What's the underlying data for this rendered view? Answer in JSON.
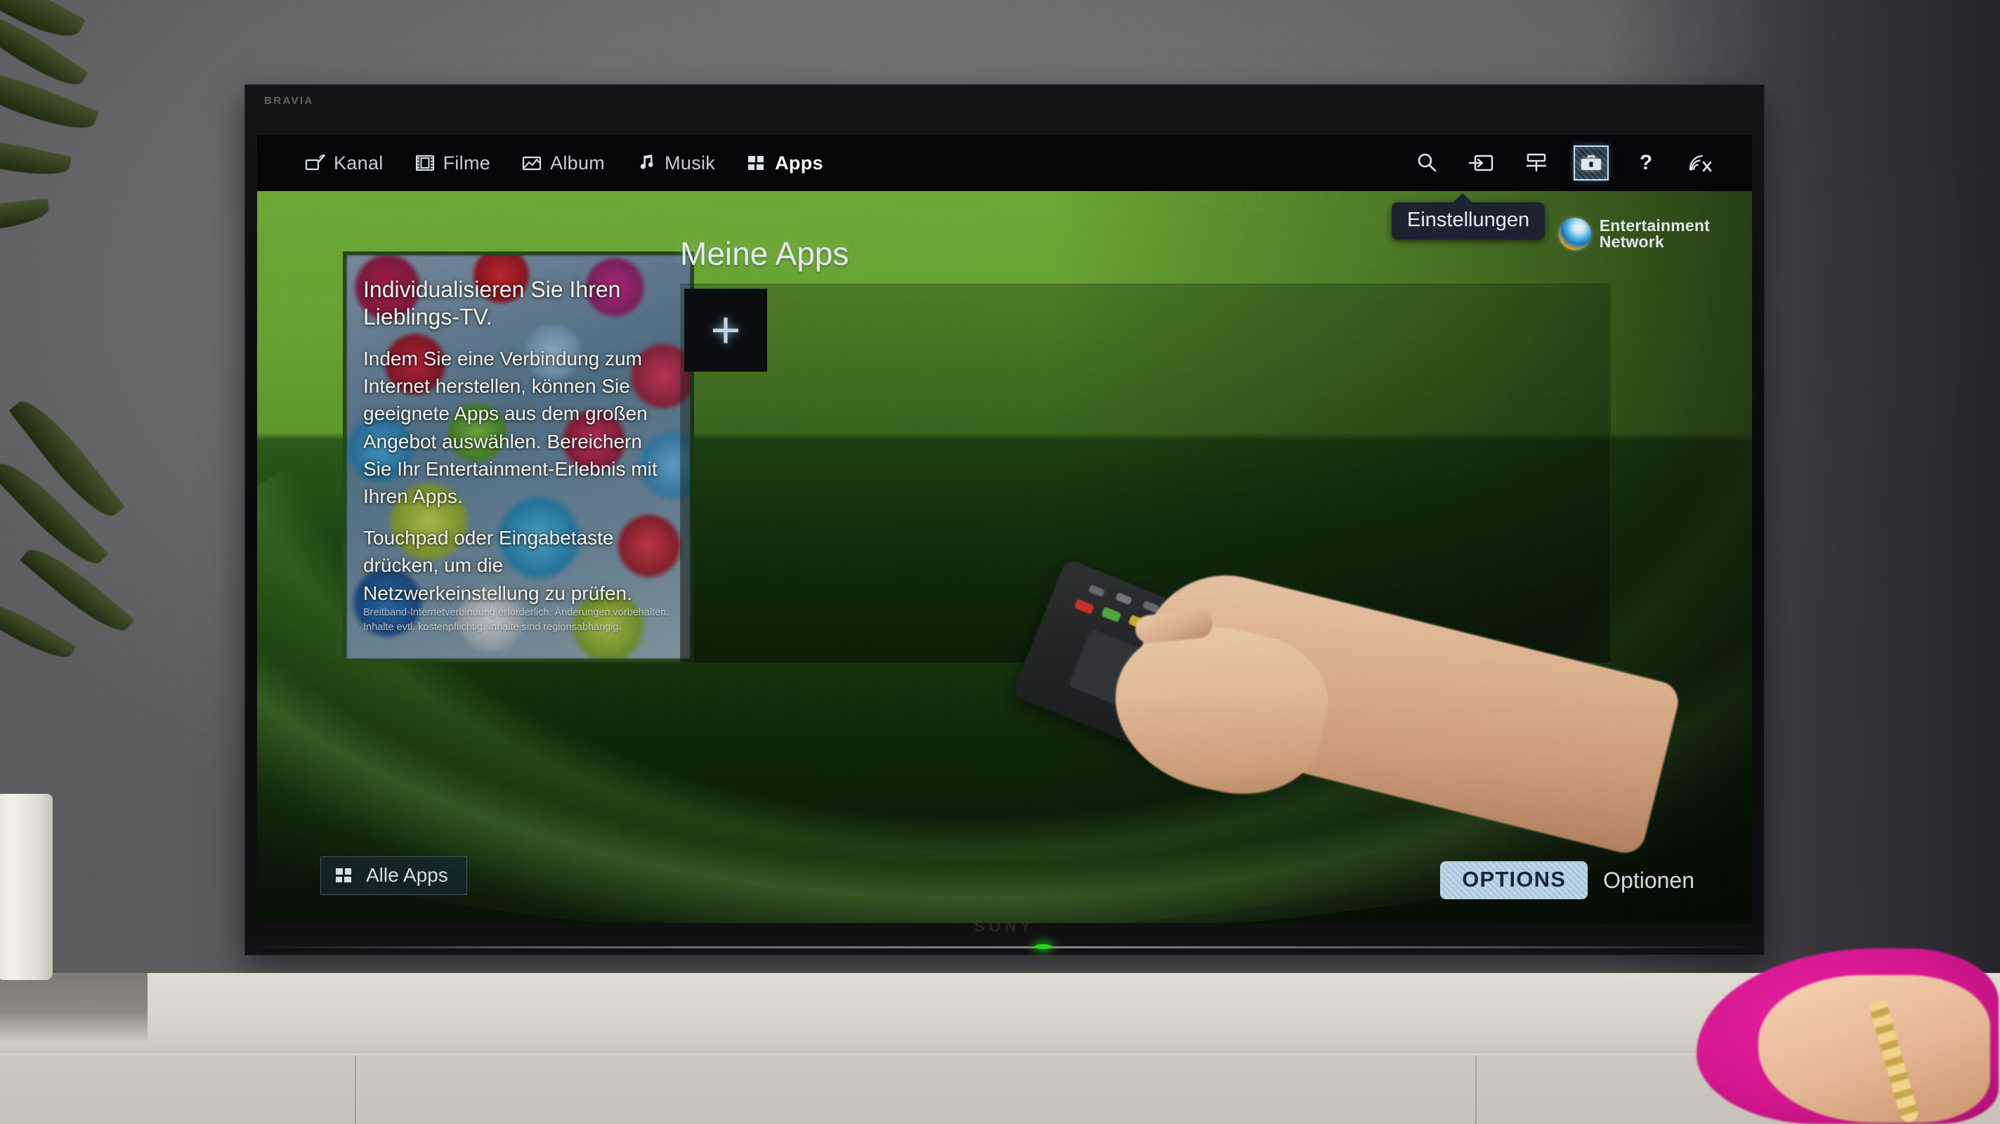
{
  "device": {
    "brand_logo_top": "BRAVIA",
    "brand_logo_bottom": "SONY"
  },
  "topbar": {
    "nav_items": [
      {
        "label": "Kanal",
        "icon": "tv-antenna-icon",
        "active": false
      },
      {
        "label": "Filme",
        "icon": "film-strip-icon",
        "active": false
      },
      {
        "label": "Album",
        "icon": "photo-icon",
        "active": false
      },
      {
        "label": "Musik",
        "icon": "music-note-icon",
        "active": false
      },
      {
        "label": "Apps",
        "icon": "apps-grid-icon",
        "active": true
      }
    ],
    "system_icons": [
      {
        "name": "search-icon",
        "selected": false
      },
      {
        "name": "input-source-icon",
        "selected": false
      },
      {
        "name": "media-server-icon",
        "selected": false
      },
      {
        "name": "settings-toolbox-icon",
        "selected": true
      },
      {
        "name": "help-icon",
        "selected": false
      },
      {
        "name": "network-disconnected-icon",
        "selected": false
      }
    ],
    "tooltip": "Einstellungen"
  },
  "branding": {
    "sen_line1": "Entertainment",
    "sen_line2": "Network",
    "sen_orb_icon": "sony-entertainment-network-orb-icon"
  },
  "promo": {
    "heading": "Individualisieren Sie Ihren Lieblings-TV.",
    "paragraph1": "Indem Sie eine Verbindung zum Internet herstellen, können Sie geeignete Apps aus dem großen Angebot auswählen. Bereichern Sie Ihr Entertainment-Erlebnis mit Ihren Apps.",
    "paragraph2": "Touchpad oder Eingabetaste drücken, um die Netzwerkeinstellung zu prüfen.",
    "fine_print": "Breitband-Internetverbindung erforderlich. Änderungen vorbehalten. Inhalte evtl. kostenpflichtig. Inhalte sind regionsabhängig."
  },
  "apps": {
    "title": "Meine Apps",
    "add_tile_label": "+",
    "all_apps_label": "Alle Apps",
    "all_apps_icon": "apps-grid-icon"
  },
  "footer": {
    "options_key": "OPTIONS",
    "options_label": "Optionen"
  },
  "colors": {
    "accent_green_top": "#6fae36",
    "accent_green_dark": "#133309",
    "highlight_blue": "#b3d2ee",
    "tooltip_bg": "#1b2330",
    "text_primary": "#ffffff",
    "led_green": "#2bd61e"
  }
}
